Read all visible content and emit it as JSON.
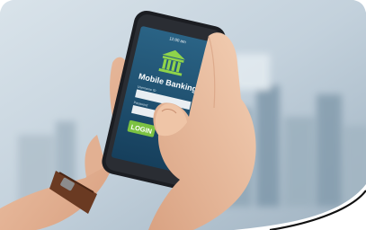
{
  "phone": {
    "status_time": "12:00 am",
    "app_title": "Mobile Banking",
    "username_label": "Username ID",
    "password_label": "Password",
    "login_label": "LOGIN",
    "icon": "bank-icon"
  },
  "colors": {
    "screen_bg": "#1d4d6e",
    "login_green": "#7cc242",
    "accent_teal": "#3aa8c9",
    "phone_body": "#1b1d22"
  }
}
